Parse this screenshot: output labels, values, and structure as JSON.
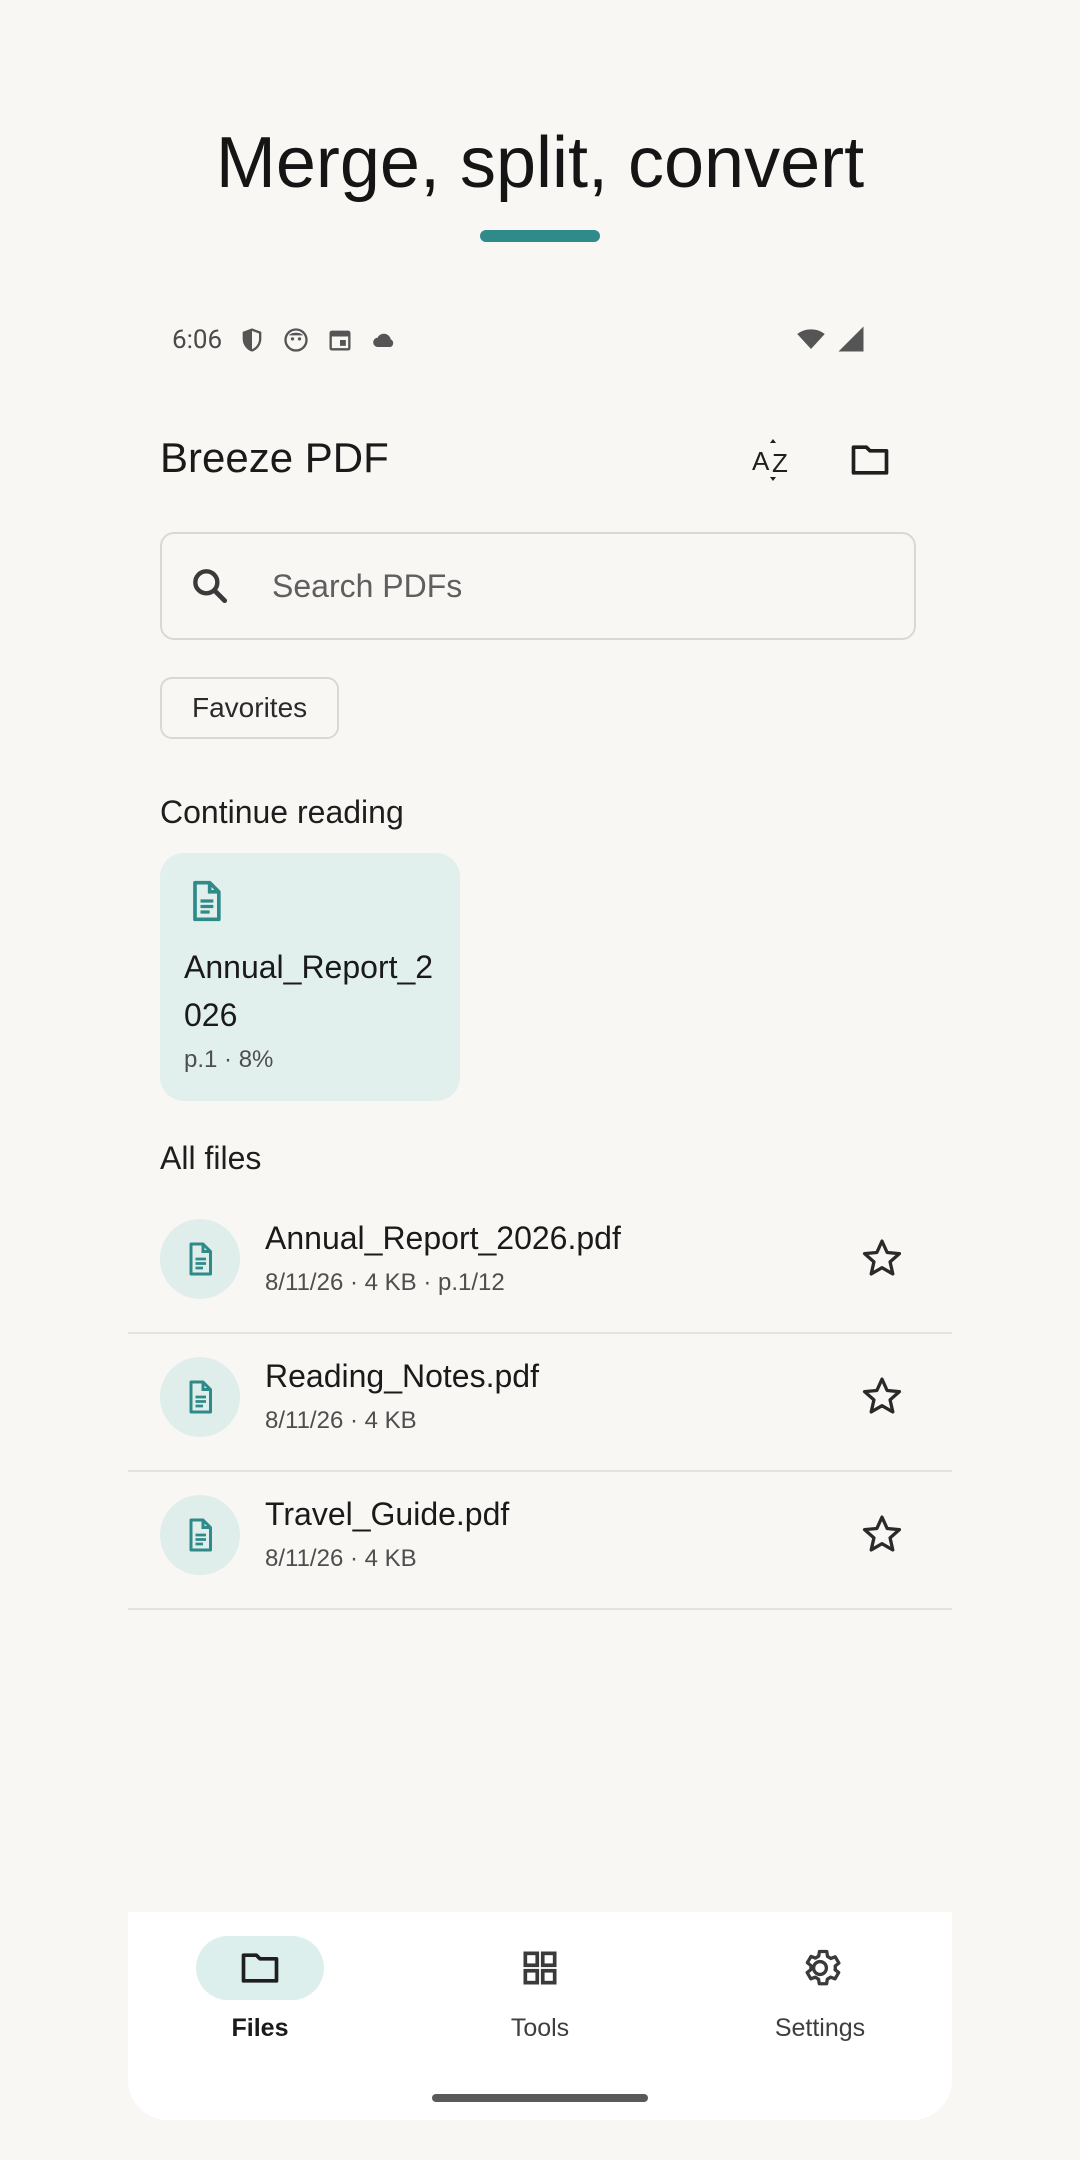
{
  "headline": {
    "text": "Merge, split, convert"
  },
  "status_bar": {
    "time": "6:06"
  },
  "appbar": {
    "title": "Breeze PDF",
    "sort_icon": "sort-az-icon",
    "folder_icon": "folder-icon"
  },
  "search": {
    "placeholder": "Search PDFs",
    "value": ""
  },
  "filter_chip": {
    "label": "Favorites"
  },
  "continue_reading": {
    "title": "Continue reading",
    "card": {
      "title": "Annual_Report_2026",
      "meta": "p.1 · 8%"
    }
  },
  "all_files": {
    "title": "All files",
    "items": [
      {
        "name": "Annual_Report_2026.pdf",
        "meta": "8/11/26 · 4 KB · p.1/12"
      },
      {
        "name": "Reading_Notes.pdf",
        "meta": "8/11/26 · 4 KB"
      },
      {
        "name": "Travel_Guide.pdf",
        "meta": "8/11/26 · 4 KB"
      }
    ]
  },
  "bottom_nav": {
    "items": [
      {
        "label": "Files",
        "active": true
      },
      {
        "label": "Tools",
        "active": false
      },
      {
        "label": "Settings",
        "active": false
      }
    ]
  },
  "colors": {
    "accent": "#2f8b89",
    "background": "#f8f7f4",
    "card_tint": "#e2f0ed"
  }
}
